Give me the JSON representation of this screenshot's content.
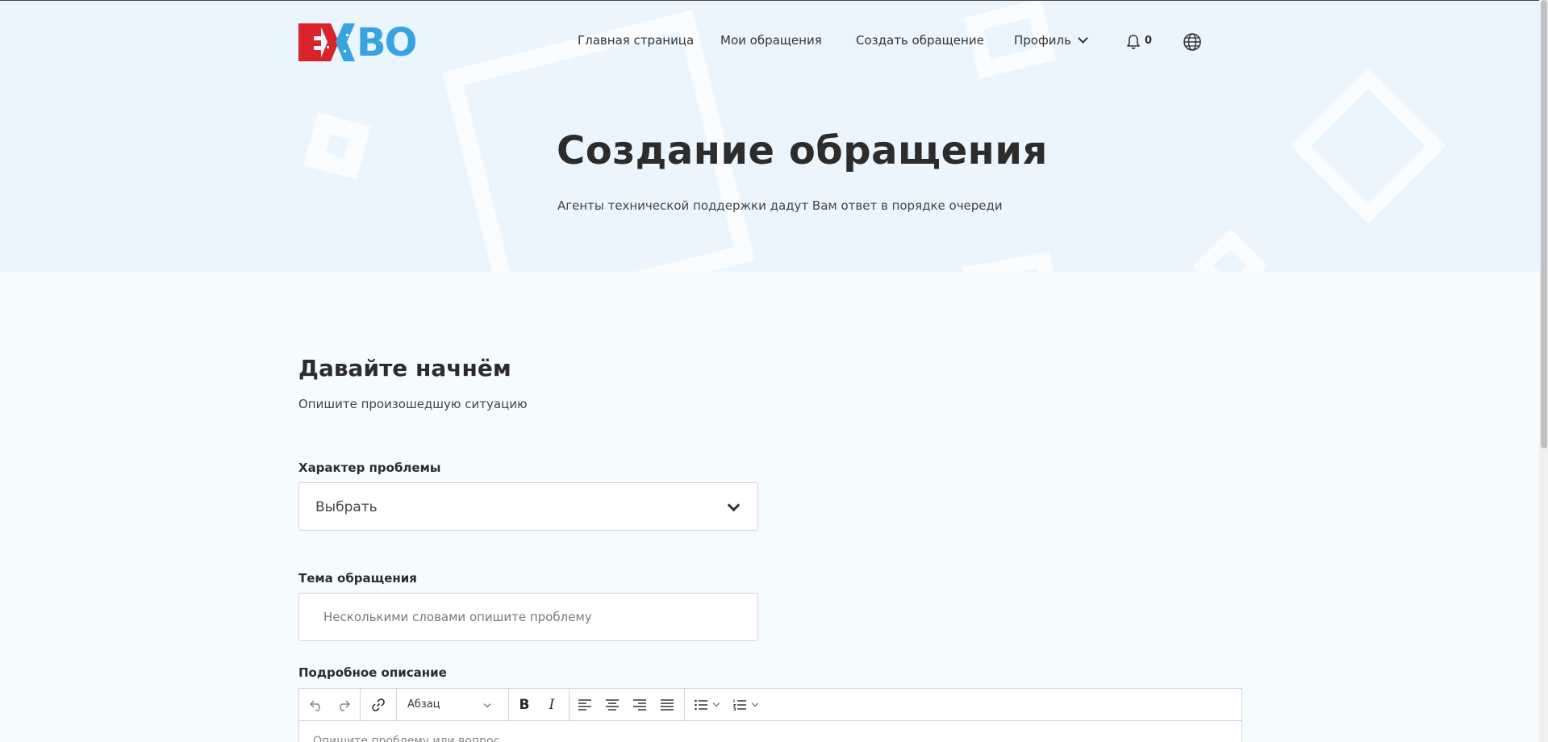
{
  "logo": {
    "text": "BO"
  },
  "nav": {
    "items": [
      {
        "label": "Главная страница"
      },
      {
        "label": "Мои обращения"
      },
      {
        "label": "Создать обращение"
      },
      {
        "label": "Профиль"
      }
    ],
    "notification_count": "0"
  },
  "hero": {
    "title": "Создание обращения",
    "subtitle": "Агенты технической поддержки дадут Вам ответ в порядке очереди"
  },
  "form": {
    "title": "Давайте начнём",
    "subtitle": "Опишите произошедшую ситуацию",
    "problem_type": {
      "label": "Характер проблемы",
      "value": "Выбрать"
    },
    "subject": {
      "label": "Тема обращения",
      "placeholder": "Несколькими словами опишите проблему",
      "value": ""
    },
    "description": {
      "label": "Подробное описание",
      "format_value": "Абзац",
      "bold_label": "B",
      "italic_label": "I",
      "placeholder": "Опишите проблему или вопрос"
    }
  },
  "colors": {
    "hero_background": "#eaf5fd",
    "page_background": "#f5fcfe",
    "logo_red": "#d8232a",
    "logo_blue": "#38a3e0"
  },
  "icons": [
    "chevron-down-icon",
    "bell-icon",
    "globe-icon",
    "undo-icon",
    "redo-icon",
    "link-icon",
    "align-left-icon",
    "align-center-icon",
    "align-right-icon",
    "align-justify-icon",
    "bullet-list-icon",
    "numbered-list-icon"
  ]
}
